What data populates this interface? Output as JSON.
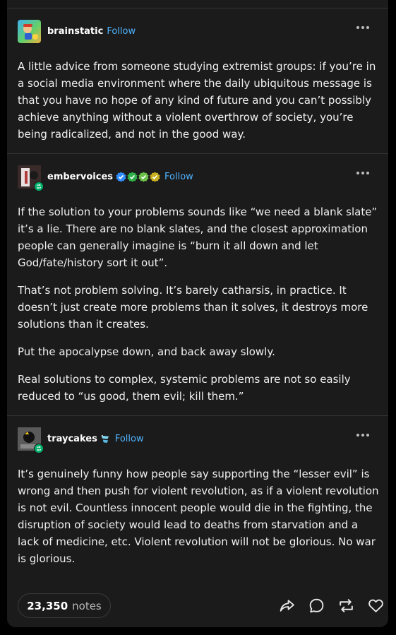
{
  "posts": [
    {
      "username": "brainstatic",
      "follow_label": "Follow",
      "paragraphs": [
        "A little advice from someone studying extremist groups: if you’re in a social media environment where the daily ubiquitous message is that you have no hope of any kind of future and you can’t possibly achieve anything without a violent overthrow of society, you’re being radicalized, and not in the good way."
      ]
    },
    {
      "username": "embervoices",
      "follow_label": "Follow",
      "badges": [
        "verified-blue-badge",
        "green-check-badge",
        "green-check-badge",
        "yellow-check-badge"
      ],
      "paragraphs": [
        "If the solution to your problems sounds like “we need a blank slate” it’s a lie. There are no blank slates, and the closest approximation people can generally imagine is “burn it all down and let God/fate/history sort it out”.",
        "That’s not problem solving. It’s barely catharsis, in practice. It doesn’t just create more problems than it solves, it destroys more solutions than it creates.",
        "Put the apocalypse down, and back away slowly.",
        "Real solutions to complex, systemic problems are not so easily reduced to “us good, them evil; kill them.”"
      ]
    },
    {
      "username": "traycakes",
      "follow_label": "Follow",
      "badges": [
        "sticker-badge"
      ],
      "paragraphs": [
        "It’s genuinely funny how people say supporting the “lesser evil” is wrong and then push for violent revolution, as if a violent revolution is not evil.  Countless innocent people would die in the fighting, the disruption of society would lead to deaths from starvation and a lack of medicine, etc.  Violent revolution will not be glorious.  No war is glorious."
      ]
    }
  ],
  "footer": {
    "notes_count": "23,350",
    "notes_label": "notes",
    "icons": [
      "share-icon",
      "reply-icon",
      "reblog-icon",
      "like-icon"
    ]
  },
  "colors": {
    "background": "#1b1b1b",
    "link": "#4fb3ff",
    "reblog_green": "#00b06a"
  }
}
